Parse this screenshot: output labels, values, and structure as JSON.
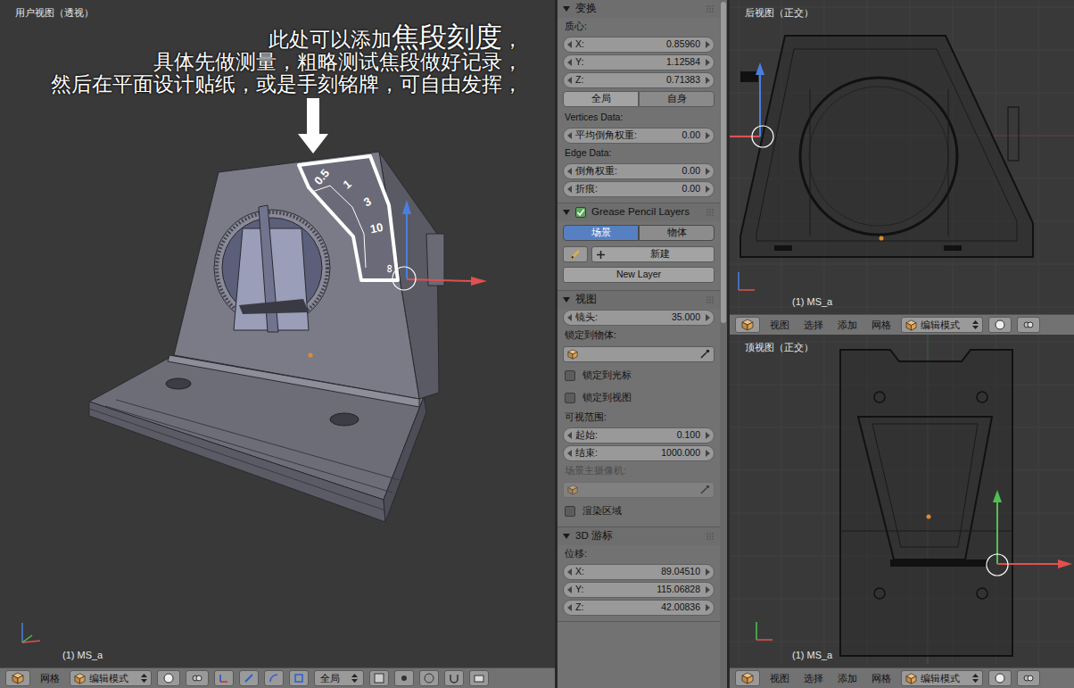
{
  "viewport_main": {
    "title": "用户视图（透视）",
    "object_label": "(1) MS_a",
    "annotation": {
      "lines": [
        {
          "segments": [
            {
              "text": "此处可以添加",
              "emphasis": false
            },
            {
              "text": "焦段刻度",
              "emphasis": true
            },
            {
              "text": "，",
              "emphasis": false
            }
          ]
        },
        {
          "segments": [
            {
              "text": "具体先做测量，粗略测试焦段做好记录，",
              "emphasis": false
            }
          ]
        },
        {
          "segments": [
            {
              "text": "然后在平面设计贴纸，或是手刻铭牌，可自由发挥，",
              "emphasis": false
            }
          ]
        }
      ]
    },
    "focal_scale": [
      "0.5",
      "1",
      "3",
      "10",
      "∞"
    ],
    "header": {
      "menus": [
        "网格"
      ],
      "mode": "编辑模式",
      "orientation": "全局"
    }
  },
  "properties": {
    "panels": [
      {
        "title": "变换",
        "expanded": true,
        "has_checkbox": false,
        "checked": false,
        "rows": [
          {
            "kind": "label",
            "text": "质心:",
            "disabled": false
          },
          {
            "kind": "number",
            "label": "X:",
            "value": "0.85960"
          },
          {
            "kind": "number",
            "label": "Y:",
            "value": "1.12584"
          },
          {
            "kind": "number",
            "label": "Z:",
            "value": "0.71383"
          },
          {
            "kind": "segmented",
            "options": [
              {
                "label": "全局",
                "selected": false
              },
              {
                "label": "自身",
                "selected": true
              }
            ]
          },
          {
            "kind": "label",
            "text": "Vertices Data:",
            "disabled": false
          },
          {
            "kind": "number",
            "label": "平均倒角权重:",
            "value": "0.00"
          },
          {
            "kind": "label",
            "text": "Edge Data:",
            "disabled": false
          },
          {
            "kind": "number",
            "label": "倒角权重:",
            "value": "0.00"
          },
          {
            "kind": "number",
            "label": "折痕:",
            "value": "0.00"
          }
        ]
      },
      {
        "title": "Grease Pencil Layers",
        "expanded": true,
        "has_checkbox": true,
        "checked": true,
        "rows": [
          {
            "kind": "tabs",
            "options": [
              {
                "label": "场景",
                "selected": true
              },
              {
                "label": "物体",
                "selected": false
              }
            ]
          },
          {
            "kind": "new",
            "label": "新建"
          },
          {
            "kind": "button",
            "label": "New Layer"
          }
        ]
      },
      {
        "title": "视图",
        "expanded": true,
        "has_checkbox": false,
        "checked": false,
        "rows": [
          {
            "kind": "number",
            "label": "镜头:",
            "value": "35.000"
          },
          {
            "kind": "label",
            "text": "锁定到物体:",
            "disabled": false
          },
          {
            "kind": "picker",
            "disabled": false
          },
          {
            "kind": "checkbox",
            "label": "锁定到光标",
            "checked": false
          },
          {
            "kind": "checkbox",
            "label": "锁定到视图",
            "checked": false
          },
          {
            "kind": "label",
            "text": "可视范围:",
            "disabled": false
          },
          {
            "kind": "number",
            "label": "起始:",
            "value": "0.100"
          },
          {
            "kind": "number",
            "label": "结束:",
            "value": "1000.000"
          },
          {
            "kind": "label",
            "text": "场景主摄像机:",
            "disabled": true
          },
          {
            "kind": "picker",
            "disabled": true
          },
          {
            "kind": "checkbox",
            "label": "渲染区域",
            "checked": false
          }
        ]
      },
      {
        "title": "3D 游标",
        "expanded": true,
        "has_checkbox": false,
        "checked": false,
        "rows": [
          {
            "kind": "label",
            "text": "位移:",
            "disabled": false
          },
          {
            "kind": "number",
            "label": "X:",
            "value": "89.04510"
          },
          {
            "kind": "number",
            "label": "Y:",
            "value": "115.06828"
          },
          {
            "kind": "number",
            "label": "Z:",
            "value": "42.00836"
          }
        ]
      }
    ]
  },
  "viewport_back": {
    "title": "后视图（正交）",
    "object_label": "(1) MS_a",
    "header": {
      "menus": [
        "视图",
        "选择",
        "添加",
        "网格"
      ],
      "mode": "编辑模式"
    }
  },
  "viewport_top": {
    "title": "顶视图（正交）",
    "object_label": "(1) MS_a",
    "header": {
      "menus": [
        "视图",
        "选择",
        "添加",
        "网格"
      ],
      "mode": "编辑模式"
    }
  }
}
